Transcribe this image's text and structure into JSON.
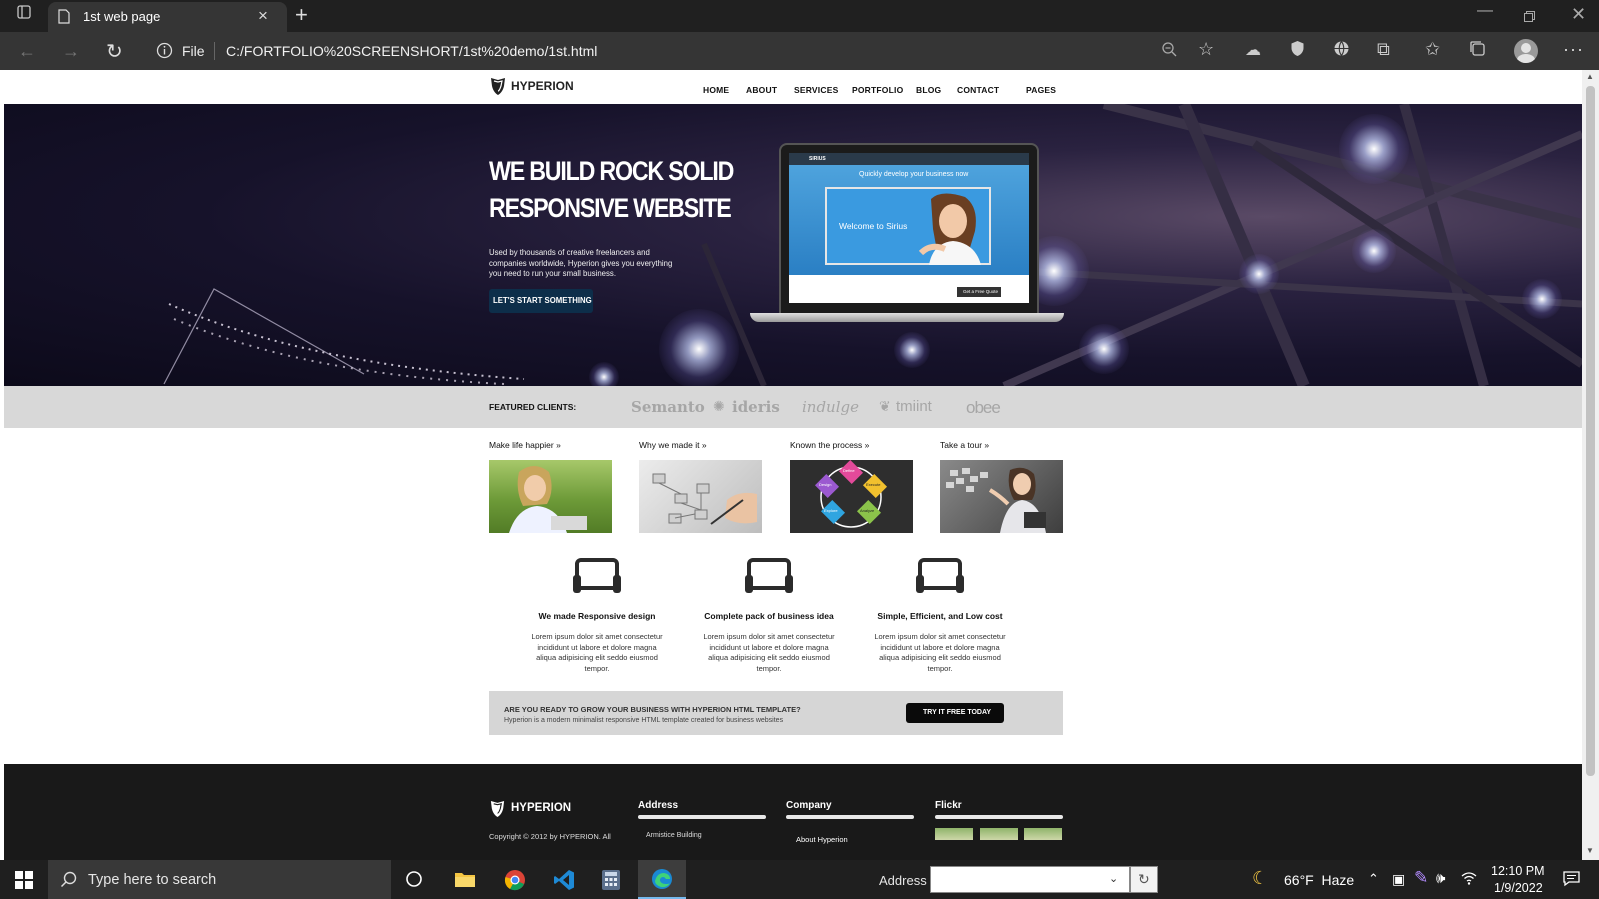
{
  "browser": {
    "tab_title": "1st web page",
    "scheme_label": "File",
    "url": "C:/FORTFOLIO%20SCREENSHORT/1st%20demo/1st.html"
  },
  "site": {
    "brand": "HYPERION",
    "nav": [
      "HOME",
      "ABOUT",
      "SERVICES",
      "PORTFOLIO",
      "BLOG",
      "CONTACT",
      "PAGES"
    ],
    "hero": {
      "headline_1": "WE BUILD ROCK SOLID",
      "headline_2": "RESPONSIVE WEBSITE",
      "text": "Used by thousands of creative freelancers and companies worldwide, Hyperion gives you everything you need to run your small business.",
      "button": "LET'S START SOMETHING",
      "mock_site_brand": "SIRIUS",
      "mock_banner": "Quickly develop your business now",
      "mock_welcome": "Welcome to Sirius",
      "mock_quote_btn": "Get a Free Quote"
    },
    "clients": {
      "label": "FEATURED CLIENTS:",
      "logos": [
        "Semanto",
        "ideris",
        "indulge",
        "tmiint",
        "obee"
      ]
    },
    "thumbs": [
      {
        "title": "Make life happier »"
      },
      {
        "title": "Why we made it »"
      },
      {
        "title": "Known the process »",
        "segments": [
          "Define",
          "Execute",
          "Analyze",
          "Explore",
          "Design"
        ]
      },
      {
        "title": "Take a tour »"
      }
    ],
    "features": [
      {
        "title": "We made Responsive design",
        "text": "Lorem ipsum dolor sit amet consectetur incididunt ut labore et dolore magna aliqua adipisicing elit seddo eiusmod tempor."
      },
      {
        "title": "Complete pack of business idea",
        "text": "Lorem ipsum dolor sit amet consectetur incididunt ut labore et dolore magna aliqua adipisicing elit seddo eiusmod tempor."
      },
      {
        "title": "Simple, Efficient, and Low cost",
        "text": "Lorem ipsum dolor sit amet consectetur incididunt ut labore et dolore magna aliqua adipisicing elit seddo eiusmod tempor."
      }
    ],
    "cta": {
      "heading": "ARE YOU READY TO GROW YOUR BUSINESS WITH HYPERION HTML TEMPLATE?",
      "sub": "Hyperion is a modern minimalist responsive HTML template created for business websites",
      "button": "TRY IT FREE TODAY"
    },
    "footer": {
      "brand": "HYPERION",
      "copyright": "Copyright © 2012 by HYPERION. All",
      "address_heading": "Address",
      "address_line": "Armistice Building",
      "company_heading": "Company",
      "company_link": "About Hyperion",
      "flickr_heading": "Flickr"
    }
  },
  "taskbar": {
    "search_placeholder": "Type here to search",
    "address_label": "Address",
    "weather": "66°F  Haze",
    "time": "12:10 PM",
    "date": "1/9/2022"
  },
  "colors": {
    "hero_button": "#0d2e4a",
    "cta_button": "#0a0a0a",
    "footer": "#191919",
    "taskbar": "#1f1f1f"
  }
}
